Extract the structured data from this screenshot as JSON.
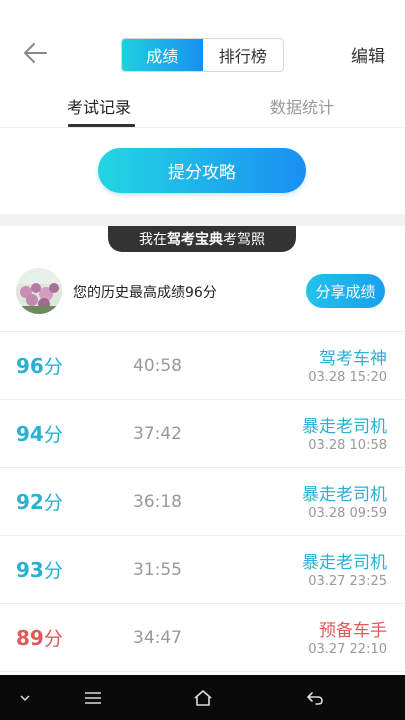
{
  "header": {
    "back_icon": "arrow-left-icon",
    "segments": [
      "成绩",
      "排行榜"
    ],
    "active_segment": 0,
    "edit_label": "编辑"
  },
  "tabs": [
    {
      "label": "考试记录",
      "active": true
    },
    {
      "label": "数据统计",
      "active": false
    }
  ],
  "cta": {
    "label": "提分攻略"
  },
  "banner": {
    "prefix": "我在",
    "brand": "驾考宝典",
    "suffix": "考驾照"
  },
  "best": {
    "text": "您的历史最高成绩96分",
    "share_label": "分享成绩"
  },
  "records": [
    {
      "score": "96",
      "unit": "分",
      "time": "40:58",
      "title": "驾考车神",
      "date": "03.28  15:20",
      "color": "blue"
    },
    {
      "score": "94",
      "unit": "分",
      "time": "37:42",
      "title": "暴走老司机",
      "date": "03.28  10:58",
      "color": "blue"
    },
    {
      "score": "92",
      "unit": "分",
      "time": "36:18",
      "title": "暴走老司机",
      "date": "03.28  09:59",
      "color": "blue"
    },
    {
      "score": "93",
      "unit": "分",
      "time": "31:55",
      "title": "暴走老司机",
      "date": "03.27  23:25",
      "color": "blue"
    },
    {
      "score": "89",
      "unit": "分",
      "time": "34:47",
      "title": "预备车手",
      "date": "03.27  22:10",
      "color": "red"
    }
  ],
  "colors": {
    "accent_start": "#1fd0e0",
    "accent_end": "#1890f0",
    "pass": "#2bb0d4",
    "fail": "#e05a5a"
  },
  "navbar": {
    "icons": [
      "chevron-down-icon",
      "menu-icon",
      "home-icon",
      "back-icon"
    ]
  }
}
